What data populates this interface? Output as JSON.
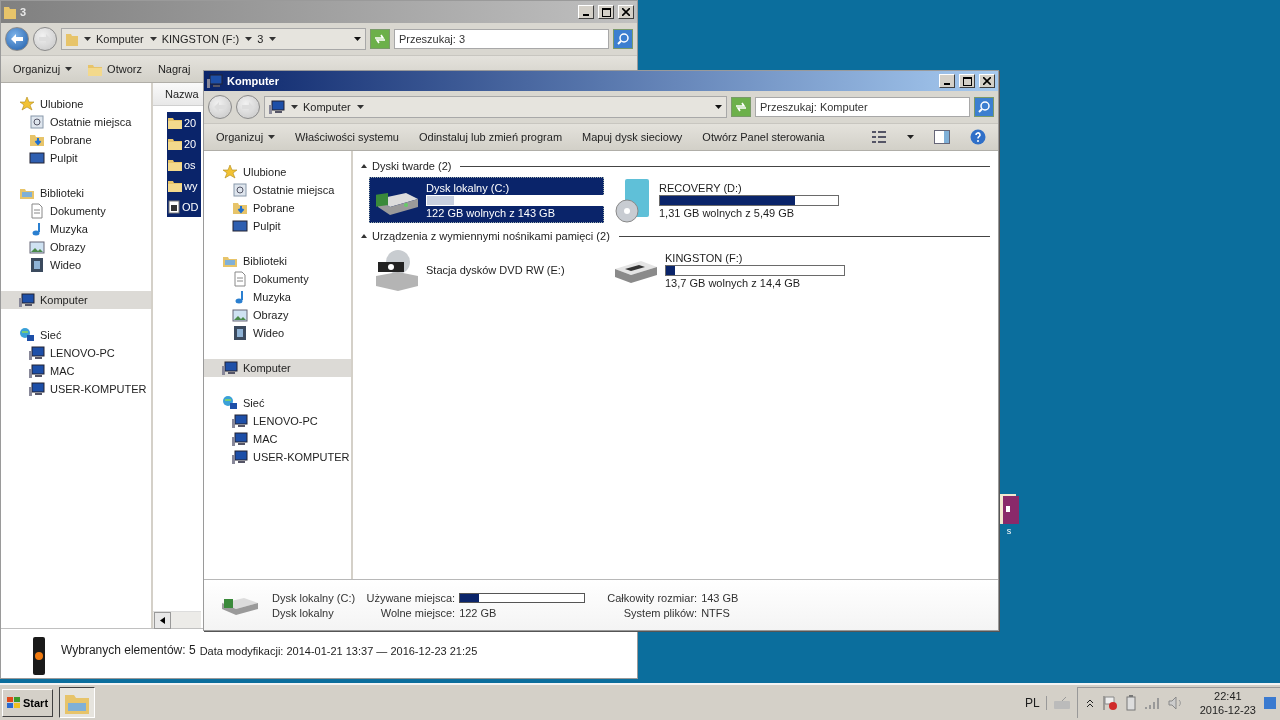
{
  "desktop": {
    "icons": [
      {
        "label": "s"
      }
    ]
  },
  "back_window": {
    "title": "3",
    "active": false,
    "breadcrumb": [
      "Komputer",
      "KINGSTON (F:)",
      "3"
    ],
    "search": {
      "placeholder": "Przeszukaj: 3"
    },
    "toolbar": [
      {
        "label": "Organizuj",
        "kind": "menu"
      },
      {
        "label": "Otworz",
        "kind": "icon"
      },
      {
        "label": "Nagraj",
        "kind": "plain"
      }
    ],
    "nav": [
      {
        "label": "Ulubione",
        "kind": "star",
        "selected": false,
        "children": [
          {
            "label": "Ostatnie miejsca",
            "kind": "recent",
            "selected": false
          },
          {
            "label": "Pobrane",
            "kind": "download",
            "selected": false
          },
          {
            "label": "Pulpit",
            "kind": "desktop",
            "selected": false
          }
        ]
      },
      {
        "label": "Biblioteki",
        "kind": "library",
        "selected": false,
        "children": [
          {
            "label": "Dokumenty",
            "kind": "document",
            "selected": false
          },
          {
            "label": "Muzyka",
            "kind": "music",
            "selected": false
          },
          {
            "label": "Obrazy",
            "kind": "picture",
            "selected": false
          },
          {
            "label": "Wideo",
            "kind": "video",
            "selected": false
          }
        ]
      },
      {
        "label": "Komputer",
        "kind": "computer",
        "selected": true
      },
      {
        "label": "Sieć",
        "kind": "network",
        "selected": false,
        "children": [
          {
            "label": "LENOVO-PC",
            "kind": "computer",
            "selected": false
          },
          {
            "label": "MAC",
            "kind": "computer",
            "selected": false
          },
          {
            "label": "USER-KOMPUTER",
            "kind": "computer",
            "selected": false
          }
        ]
      }
    ],
    "column_header": "Nazwa",
    "files": [
      {
        "name": "20",
        "kind": "folder",
        "selected": true
      },
      {
        "name": "20",
        "kind": "folder",
        "selected": true
      },
      {
        "name": "os",
        "kind": "folder",
        "selected": true
      },
      {
        "name": "wy",
        "kind": "folder",
        "selected": true
      },
      {
        "name": "OD",
        "kind": "file",
        "selected": true
      }
    ],
    "status": {
      "count": "Wybranych elementów: 5",
      "modified": "Data modyfikacji: 2014-01-21 13:37 — 2016-12-23 21:25"
    }
  },
  "front_window": {
    "title": "Komputer",
    "active": true,
    "breadcrumb": [
      "Komputer"
    ],
    "search": {
      "placeholder": "Przeszukaj: Komputer"
    },
    "toolbar": [
      {
        "label": "Organizuj",
        "kind": "menu"
      },
      {
        "label": "Właściwości systemu",
        "kind": "plain"
      },
      {
        "label": "Odinstaluj lub zmień program",
        "kind": "plain"
      },
      {
        "label": "Mapuj dysk sieciowy",
        "kind": "plain"
      },
      {
        "label": "Otwórz Panel sterowania",
        "kind": "plain"
      }
    ],
    "nav": [
      {
        "label": "Ulubione",
        "kind": "star",
        "selected": false,
        "children": [
          {
            "label": "Ostatnie miejsca",
            "kind": "recent",
            "selected": false
          },
          {
            "label": "Pobrane",
            "kind": "download",
            "selected": false
          },
          {
            "label": "Pulpit",
            "kind": "desktop",
            "selected": false
          }
        ]
      },
      {
        "label": "Biblioteki",
        "kind": "library",
        "selected": false,
        "children": [
          {
            "label": "Dokumenty",
            "kind": "document",
            "selected": false
          },
          {
            "label": "Muzyka",
            "kind": "music",
            "selected": false
          },
          {
            "label": "Obrazy",
            "kind": "picture",
            "selected": false
          },
          {
            "label": "Wideo",
            "kind": "video",
            "selected": false
          }
        ]
      },
      {
        "label": "Komputer",
        "kind": "computer",
        "selected": true
      },
      {
        "label": "Sieć",
        "kind": "network",
        "selected": false,
        "children": [
          {
            "label": "LENOVO-PC",
            "kind": "computer",
            "selected": false
          },
          {
            "label": "MAC",
            "kind": "computer",
            "selected": false
          },
          {
            "label": "USER-KOMPUTER",
            "kind": "computer",
            "selected": false
          }
        ]
      }
    ],
    "groups": [
      {
        "title": "Dyski twarde (2)",
        "expanded": true,
        "drives": [
          {
            "name": "Dysk lokalny (C:)",
            "kind": "system",
            "selected": true,
            "level": 0.15,
            "free": "122 GB wolnych z 143 GB"
          },
          {
            "name": "RECOVERY (D:)",
            "kind": "recovery",
            "selected": false,
            "level": 0.76,
            "free": "1,31 GB wolnych z 5,49 GB"
          }
        ]
      },
      {
        "title": "Urządzenia z wymiennymi nośnikami pamięci (2)",
        "expanded": true,
        "drives": [
          {
            "name": "Stacja dysków DVD RW (E:)",
            "kind": "dvd",
            "selected": false
          },
          {
            "name": "KINGSTON (F:)",
            "kind": "removable",
            "selected": false,
            "level": 0.05,
            "free": "13,7 GB wolnych z 14,4 GB"
          }
        ]
      }
    ],
    "details": {
      "rows": [
        {
          "title": "Dysk lokalny (C:)",
          "fields": [
            {
              "label": "Używane miejsca:",
              "level": 0.15
            },
            {
              "label": "Całkowity rozmiar:",
              "value": "143 GB"
            }
          ]
        },
        {
          "title": "Dysk lokalny",
          "fields": [
            {
              "label": "Wolne miejsce:",
              "value": "122 GB"
            },
            {
              "label": "System plików:",
              "value": "NTFS"
            }
          ]
        }
      ]
    }
  },
  "taskbar": {
    "start": "Start",
    "language": "PL",
    "time": "22:41",
    "date": "2016-12-23"
  }
}
